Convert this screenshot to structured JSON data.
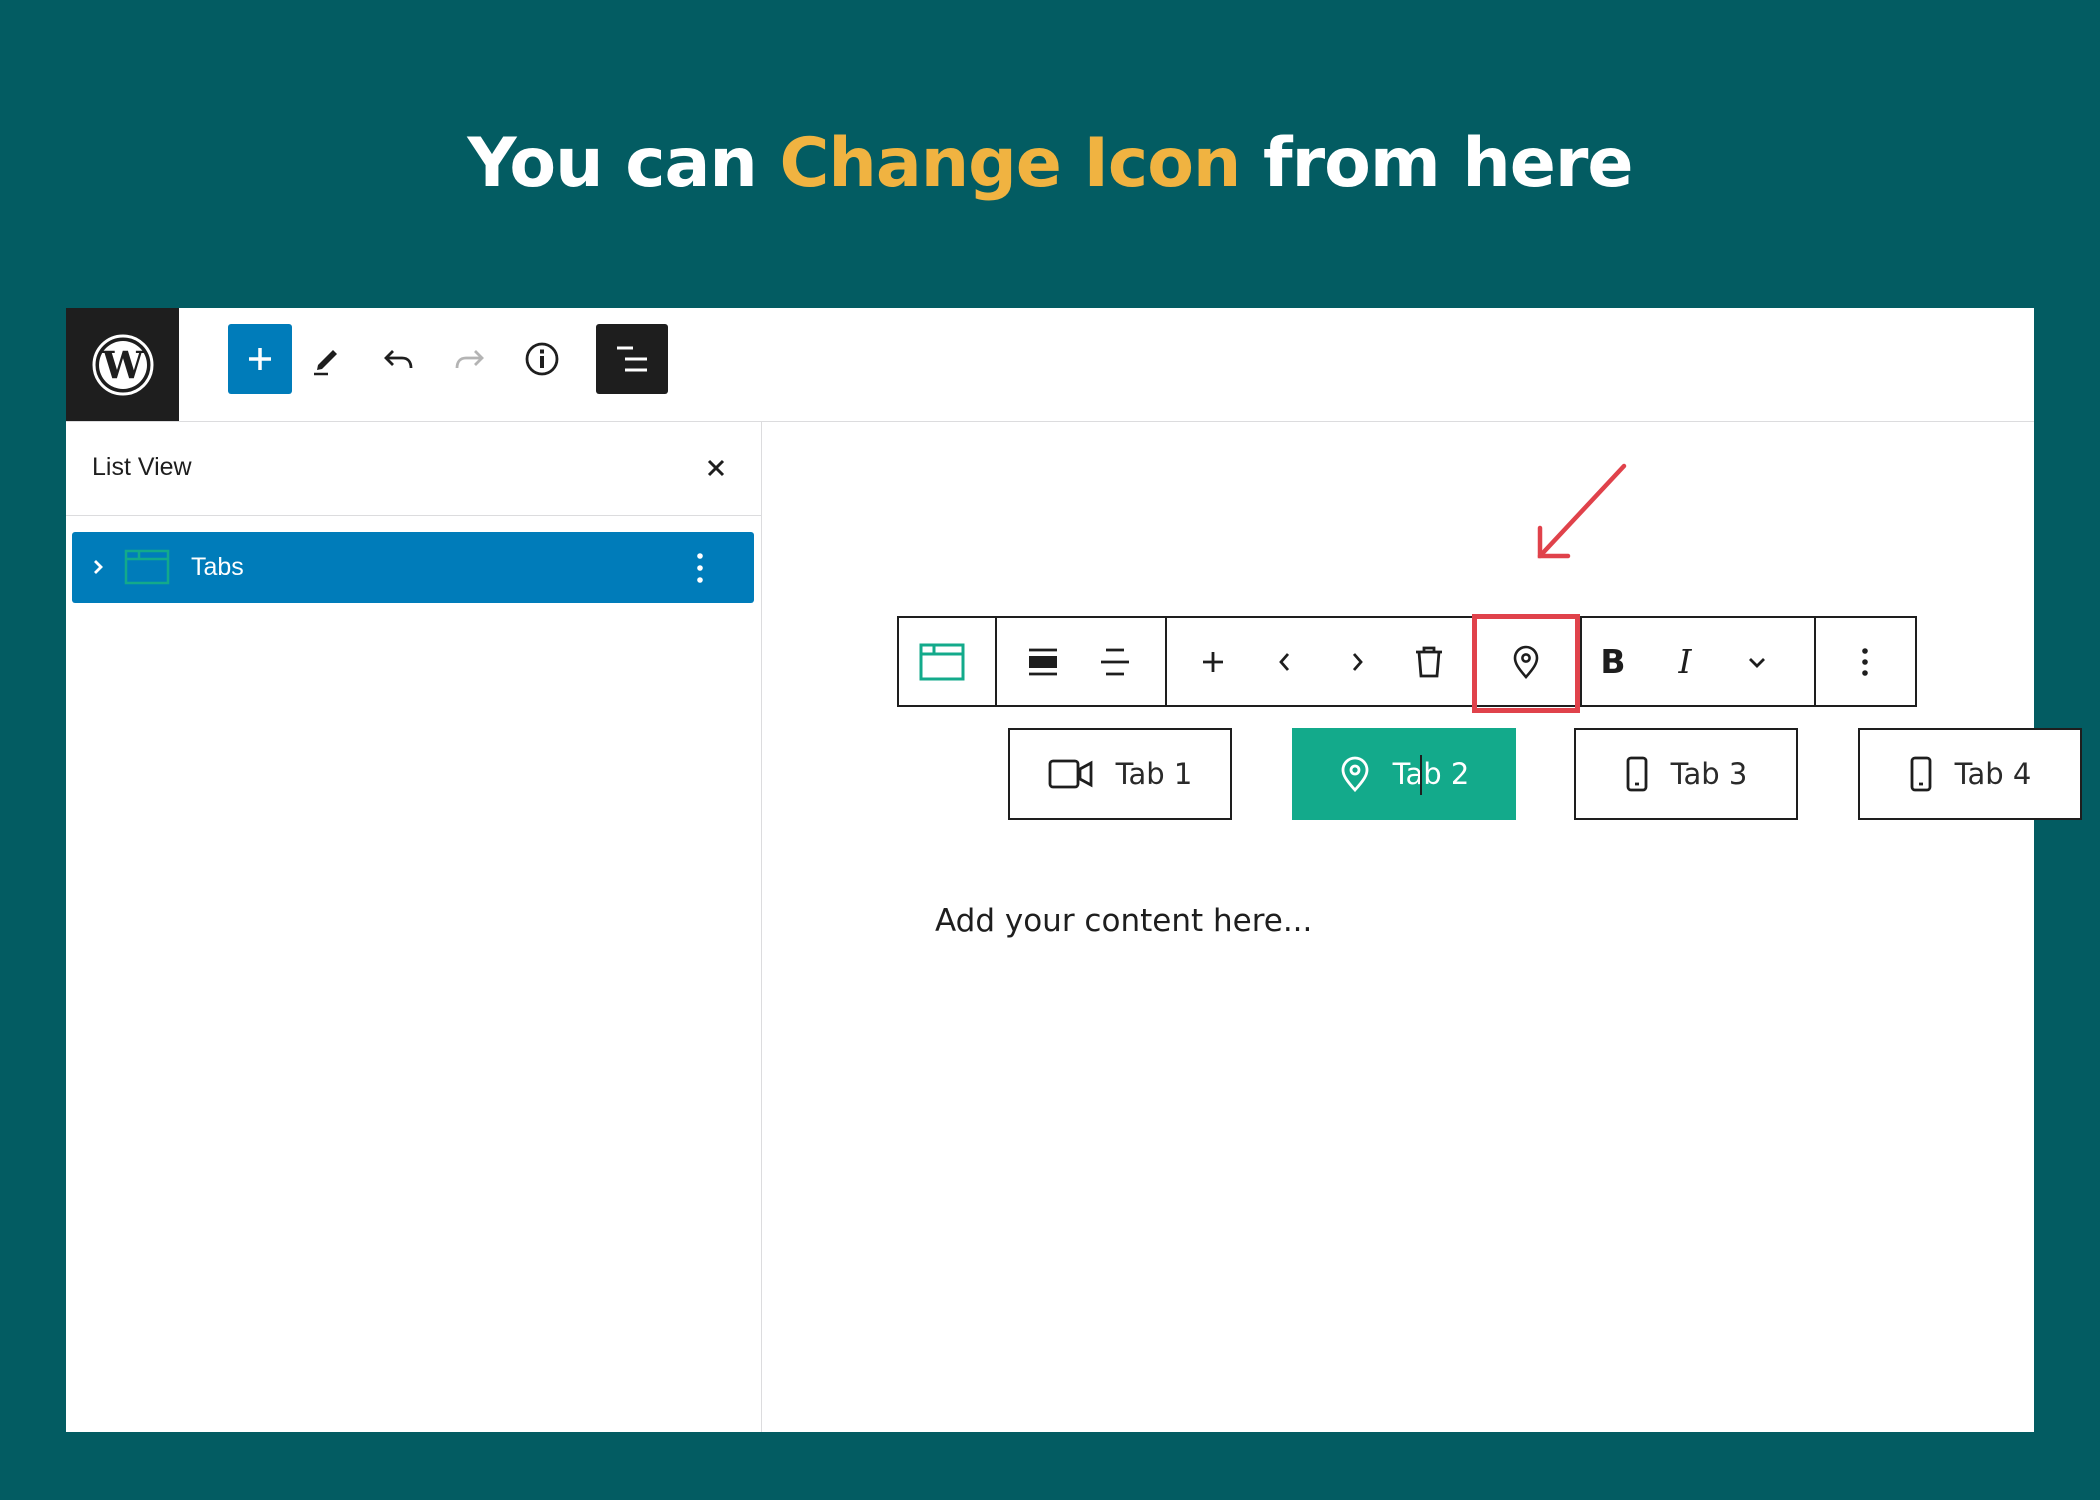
{
  "headline": {
    "before": "You can ",
    "accent": "Change Icon",
    "after": " from here"
  },
  "colors": {
    "background": "#035c62",
    "accent": "#f0b341",
    "wp_blue": "#007cba",
    "tab_active": "#13aa8b",
    "highlight": "#e0424b"
  },
  "topbar": {
    "logo": "wordpress-icon",
    "buttons": [
      "add-block-icon",
      "edit-icon",
      "undo-icon",
      "redo-icon",
      "info-icon",
      "list-view-icon"
    ]
  },
  "sidebar": {
    "title": "List View",
    "items": [
      {
        "label": "Tabs",
        "icon": "tabs-block-icon"
      }
    ]
  },
  "block_toolbar": {
    "buttons": [
      "tabs-block-icon",
      "justify-icon",
      "align-center-icon",
      "add-icon",
      "previous-icon",
      "next-icon",
      "trash-icon",
      "location-pin-icon",
      "B",
      "I",
      "chevron-down-icon",
      "more-options-icon"
    ],
    "highlighted": "location-pin-icon"
  },
  "tabs": [
    {
      "label": "Tab 1",
      "icon": "video-camera-icon",
      "active": false
    },
    {
      "label": "Tab 2",
      "icon": "location-pin-icon",
      "active": true
    },
    {
      "label": "Tab 3",
      "icon": "smartphone-icon",
      "active": false
    },
    {
      "label": "Tab 4",
      "icon": "smartphone-icon",
      "active": false
    }
  ],
  "content": {
    "placeholder": "Add your content here..."
  }
}
